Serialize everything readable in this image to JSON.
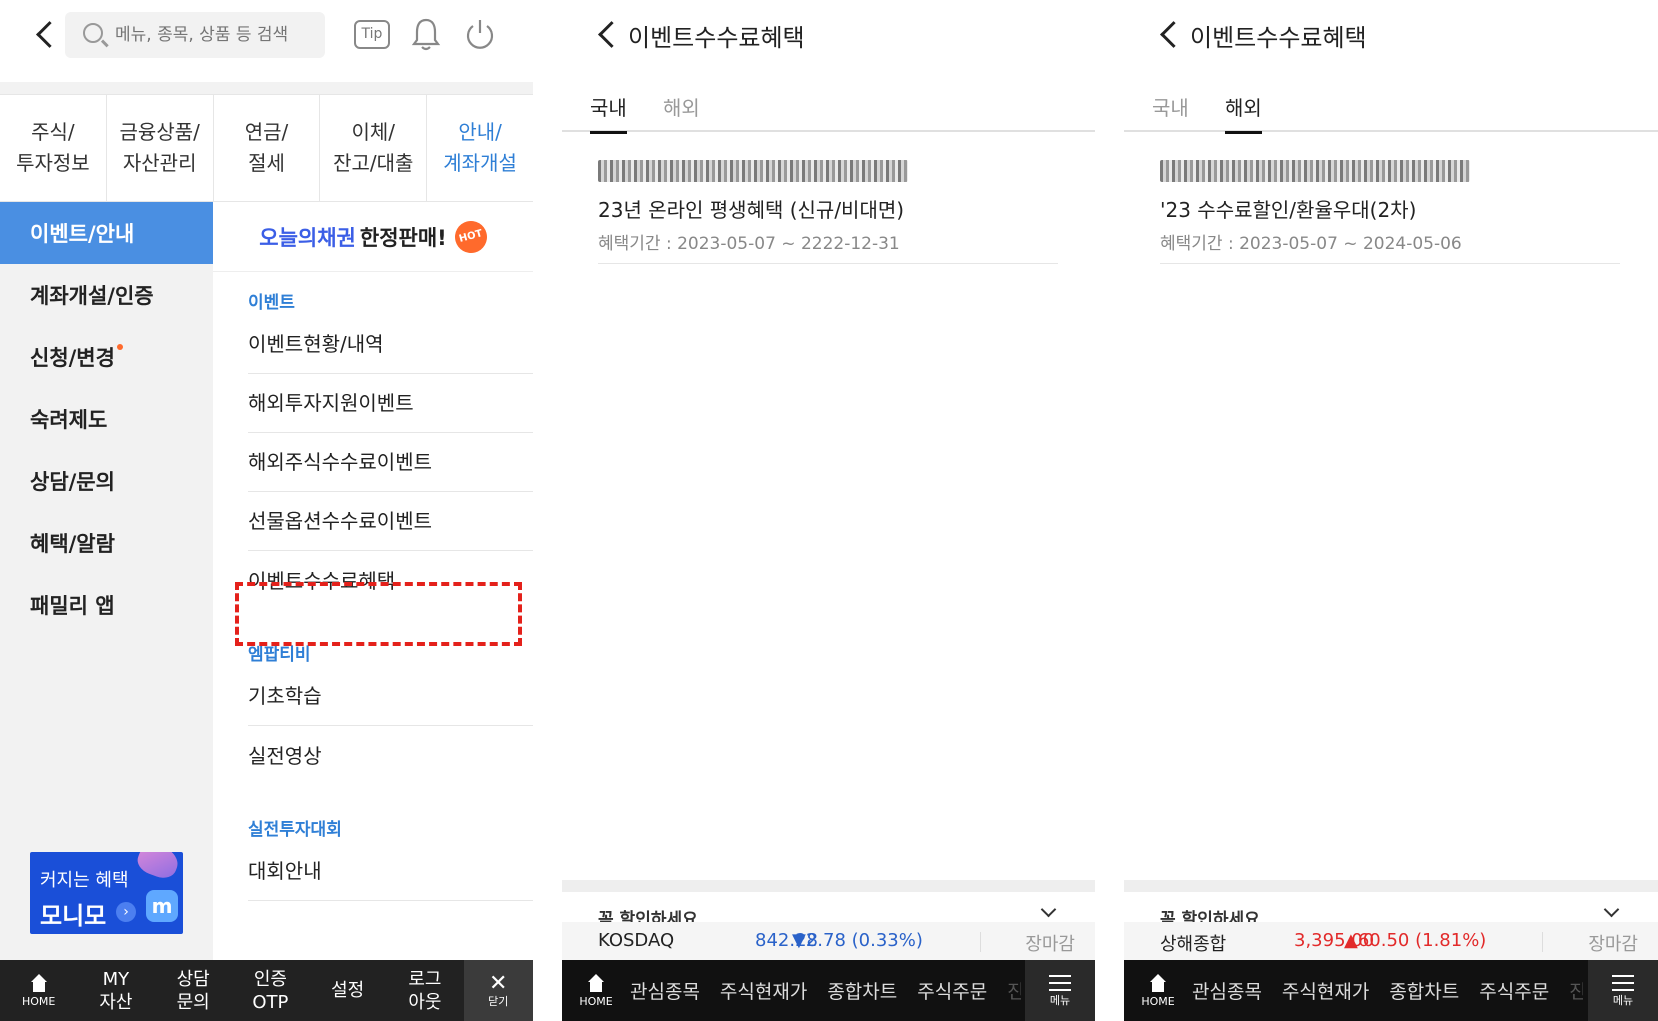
{
  "screen1": {
    "search_placeholder": "메뉴, 종목, 상품 등 검색",
    "tip_label": "Tip",
    "category_tabs": [
      "주식/\n투자정보",
      "금융상품/\n자산관리",
      "연금/\n절세",
      "이체/\n잔고/대출",
      "안내/\n계좌개설"
    ],
    "active_category": 4,
    "sidebar": [
      "이벤트/안내",
      "계좌개설/인증",
      "신청/변경",
      "숙려제도",
      "상담/문의",
      "혜택/알람",
      "패밀리 앱"
    ],
    "banner": {
      "highlight": "오늘의채권",
      "rest": "한정판매!",
      "badge": "HOT"
    },
    "sections": [
      {
        "head": "이벤트",
        "items": [
          "이벤트현황/내역",
          "해외투자지원이벤트",
          "해외주식수수료이벤트",
          "선물옵션수수료이벤트",
          "이벤트수수료혜택"
        ]
      },
      {
        "head": "엠팝티비",
        "items": [
          "기초학습",
          "실전영상"
        ]
      },
      {
        "head": "실전투자대회",
        "items": [
          "대회안내"
        ]
      }
    ],
    "promo": {
      "line1": "커지는 혜택",
      "line2": "모니모",
      "logo": "m"
    },
    "bottom_nav": [
      "HOME",
      "MY\n자산",
      "상담\n문의",
      "인증\nOTP",
      "설정",
      "로그\n아웃",
      "닫기"
    ]
  },
  "screen2": {
    "title": "이벤트수수료혜택",
    "tabs": [
      "국내",
      "해외"
    ],
    "active_tab": 0,
    "card": {
      "title": "23년 온라인 평생혜택 (신규/비대면)",
      "period": "혜택기간 : 2023-05-07 ~ 2222-12-31"
    },
    "peek": "꼭 할인하세요",
    "ticker": {
      "name": "KOSDAQ",
      "price": "842.28",
      "change": "▼2.78 (0.33%)",
      "direction": "down",
      "status": "장마감"
    },
    "nav": [
      "HOME",
      "관심종목",
      "주식현재가",
      "종합차트",
      "주식주문",
      "진",
      "메뉴"
    ]
  },
  "screen3": {
    "title": "이벤트수수료혜택",
    "tabs": [
      "국내",
      "해외"
    ],
    "active_tab": 1,
    "card": {
      "title": "'23 수수료할인/환율우대(2차)",
      "period": "혜택기간 : 2023-05-07 ~ 2024-05-06"
    },
    "peek": "꼭 할인하세요",
    "ticker": {
      "name": "상해종합",
      "price": "3,395.00",
      "change": "▲60.50 (1.81%)",
      "direction": "up",
      "status": "장마감"
    },
    "nav": [
      "HOME",
      "관심종목",
      "주식현재가",
      "종합차트",
      "주식주문",
      "진",
      "메뉴"
    ]
  },
  "colors": {
    "accent_blue": "#4a8fe2",
    "highlight_red": "#e4211b",
    "down": "#2a62c9",
    "up": "#e22a2a"
  }
}
